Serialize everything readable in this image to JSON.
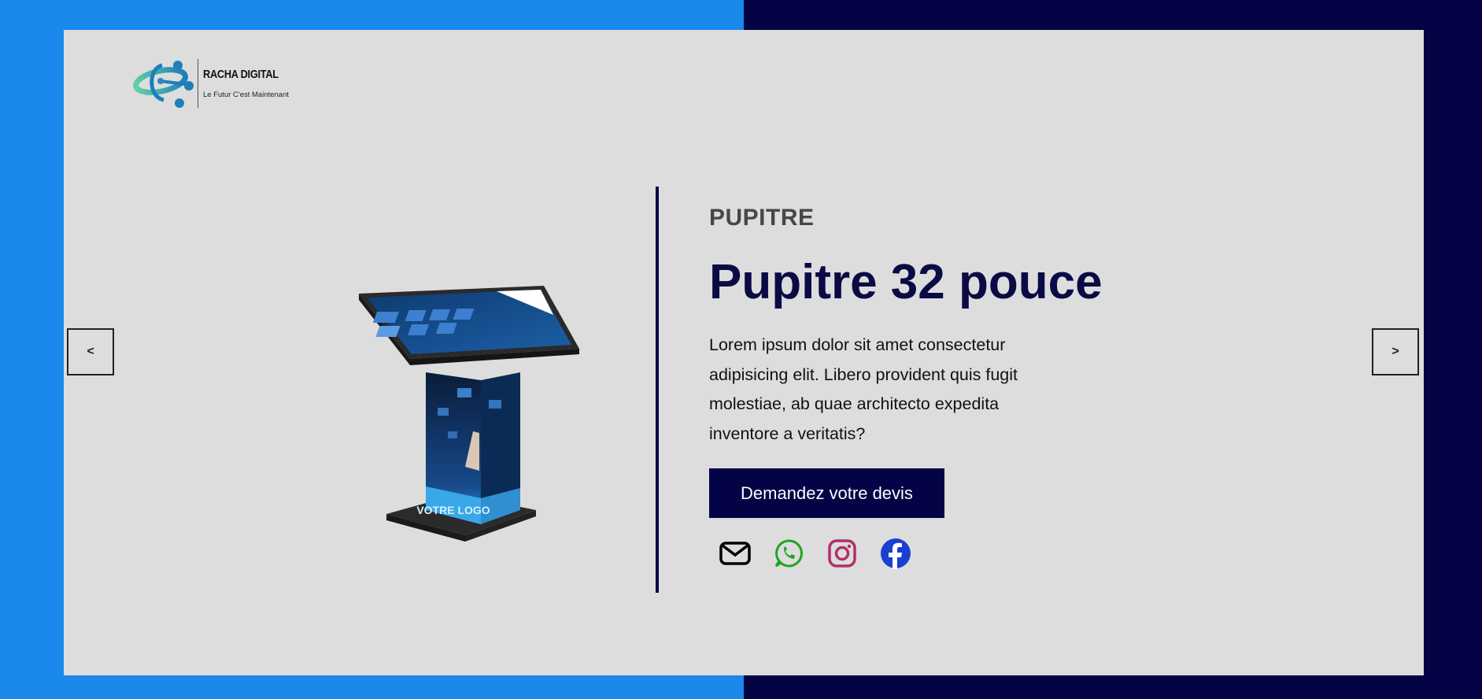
{
  "brand": {
    "name": "RACHA DIGITAL",
    "tagline": "Le Futur C'est Maintenant",
    "logo_icon": "atom-orbit-logo"
  },
  "slider": {
    "prev_label": "<",
    "next_label": ">"
  },
  "product": {
    "category": "PUPITRE",
    "title": "Pupitre 32 pouce",
    "description": "Lorem ipsum dolor sit amet consectetur adipisicing elit. Libero provident quis fugit molestiae, ab quae architecto expedita inventore a veritatis?",
    "cta_label": "Demandez votre devis",
    "image_icon": "touch-kiosk-image",
    "image_logo_text": "VOTRE LOGO"
  },
  "socials": [
    {
      "name": "email",
      "icon": "envelope-icon",
      "color": "#000000"
    },
    {
      "name": "whatsapp",
      "icon": "whatsapp-icon",
      "color": "#1ea51e"
    },
    {
      "name": "instagram",
      "icon": "instagram-icon",
      "color": "#b0306a"
    },
    {
      "name": "facebook",
      "icon": "facebook-icon",
      "color": "#1a3fd1"
    }
  ],
  "colors": {
    "left_bg": "#1b89ec",
    "right_bg": "#040345",
    "card_bg": "#dddddd",
    "accent": "#040345"
  }
}
